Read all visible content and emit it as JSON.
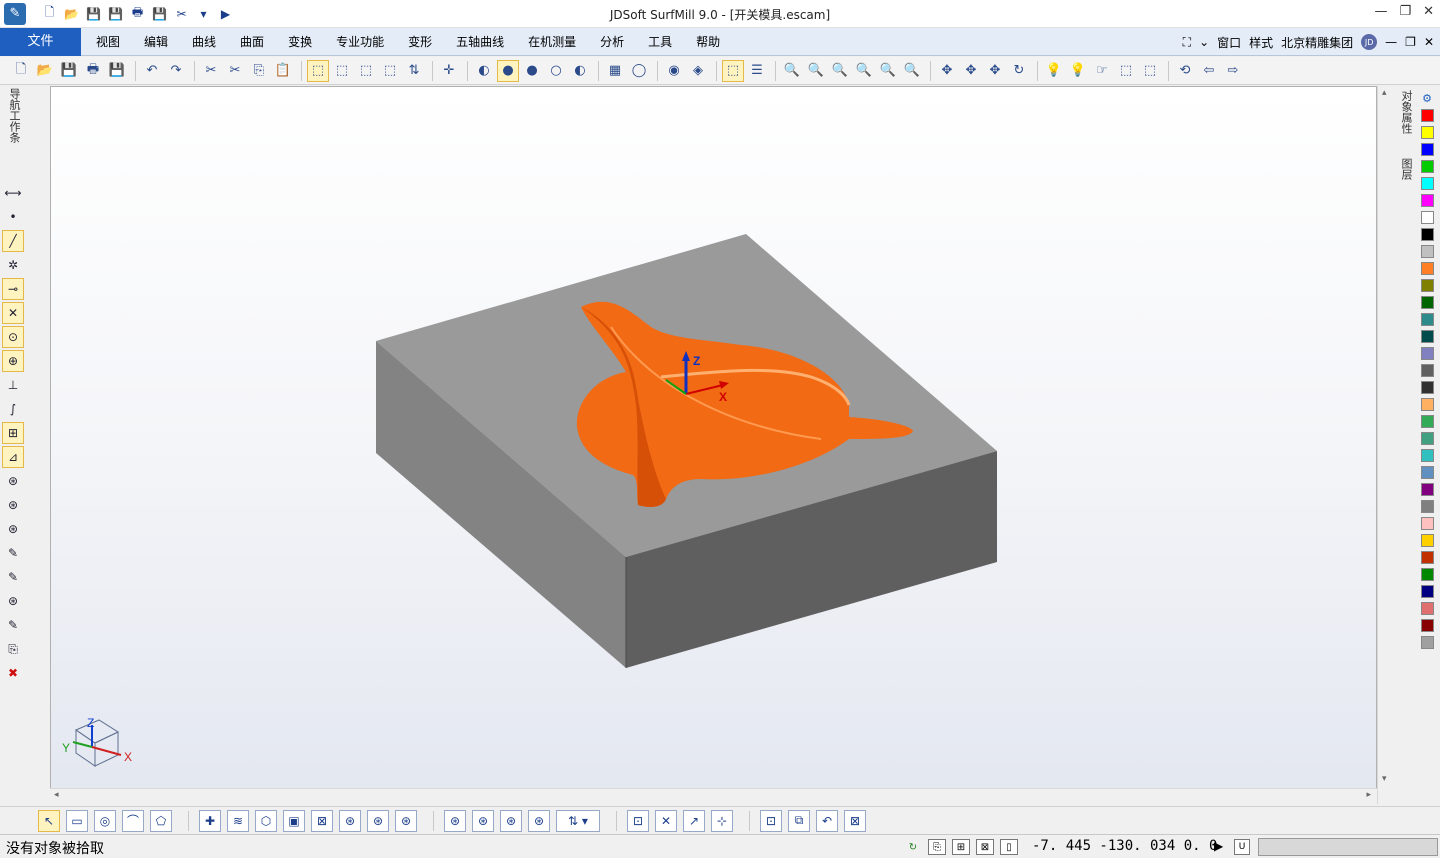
{
  "app": {
    "title": "JDSoft SurfMill 9.0 - [开关模具.escam]"
  },
  "quick_access": [
    {
      "icon": "new-file-icon",
      "glyph": "🗋"
    },
    {
      "icon": "open-file-icon",
      "glyph": "📂"
    },
    {
      "icon": "save-icon",
      "glyph": "💾"
    },
    {
      "icon": "save-as-icon",
      "glyph": "💾"
    },
    {
      "icon": "print-icon",
      "glyph": "🖶"
    },
    {
      "icon": "save-all-icon",
      "glyph": "💾"
    },
    {
      "icon": "tools-icon",
      "glyph": "✂"
    },
    {
      "icon": "dropdown-icon",
      "glyph": "▾"
    },
    {
      "icon": "play-icon",
      "glyph": "▶"
    }
  ],
  "window_controls": {
    "minimize": "—",
    "restore": "❐",
    "close": "✕"
  },
  "menu": {
    "file": "文件",
    "items": [
      "视图",
      "编辑",
      "曲线",
      "曲面",
      "变换",
      "专业功能",
      "变形",
      "五轴曲线",
      "在机测量",
      "分析",
      "工具",
      "帮助"
    ],
    "right": {
      "window": "窗口",
      "style": "样式",
      "company": "北京精雕集团",
      "avatar": "JD"
    }
  },
  "toolbar_groups": [
    [
      "🗋",
      "📂",
      "💾",
      "🖶",
      "💾"
    ],
    [
      "↶",
      "↷"
    ],
    [
      "✂",
      "✂",
      "⎘",
      "📋"
    ],
    [
      "⬚",
      "⬚",
      "⬚",
      "⬚",
      "⇅"
    ],
    [
      "✛"
    ],
    [
      "◐",
      "●",
      "●",
      "○",
      "◐"
    ],
    [
      "▦",
      "◯"
    ],
    [
      "◉",
      "◈"
    ],
    [
      "⬚",
      "☰"
    ],
    [
      "🔍",
      "🔍",
      "🔍",
      "🔍",
      "🔍",
      "🔍"
    ],
    [
      "✥",
      "✥",
      "✥",
      "↻"
    ],
    [
      "💡",
      "💡",
      "☞",
      "⬚",
      "⬚"
    ],
    [
      "⟲",
      "⇦",
      "⇨"
    ]
  ],
  "left_panel": {
    "tab_label": "导航工作条"
  },
  "left_tools": [
    "⟷",
    "•",
    "╱",
    "✲",
    "⊸",
    "✕",
    "⊙",
    "⊕",
    "⊥",
    "∫",
    "⊞",
    "⊿",
    "⊛",
    "⊛",
    "⊛",
    "✎",
    "✎",
    "⊛",
    "✎",
    "⎘",
    "✖"
  ],
  "right_panel": {
    "tab_object_properties": "对象属性",
    "tab_layers": "图层"
  },
  "palette": [
    "#ff0000",
    "#ffff00",
    "#0000ff",
    "#00cc00",
    "#00ffff",
    "#ff00ff",
    "#ffffff",
    "#000000",
    "#c0c0c0",
    "#ff7f27",
    "#808000",
    "#006400",
    "#2e8b8b",
    "#004c4c",
    "#8080c0",
    "#606060",
    "#303030",
    "#ffb060",
    "#33aa55",
    "#40a080",
    "#30c0c0",
    "#6090c0",
    "#800080",
    "#808080",
    "#ffc0c0",
    "#ffd000",
    "#c03000",
    "#008800",
    "#000080",
    "#e07070",
    "#880000",
    "#a0a0a0"
  ],
  "viewport": {
    "axis_z": "Z",
    "axis_x": "X",
    "triad_z": "Z",
    "triad_y": "Y",
    "triad_x": "X",
    "colors": {
      "part_top": "#9a9a9a",
      "part_left": "#838383",
      "part_front": "#5f5f5f",
      "cavity": "#f26a14"
    }
  },
  "bottom_toolbar_groups": [
    [
      "↖",
      "▭",
      "◎",
      "⌒",
      "⬠"
    ],
    [
      "✚",
      "≋",
      "⬡",
      "▣",
      "⊠",
      "⊛",
      "⊛",
      "⊛"
    ],
    [
      "⊛",
      "⊛",
      "⊛",
      "⊛",
      "⇅ ▾"
    ],
    [
      "⊡",
      "✕",
      "↗",
      "⊹"
    ],
    [
      "⊡",
      "⧉",
      "↶",
      "⊠"
    ]
  ],
  "status": {
    "message": "没有对象被拾取",
    "coords": "-7. 445  -130. 034  0. 0",
    "u_label": "U",
    "icons": [
      "↻",
      "⎘",
      "⊞",
      "⊠",
      "▯"
    ]
  }
}
